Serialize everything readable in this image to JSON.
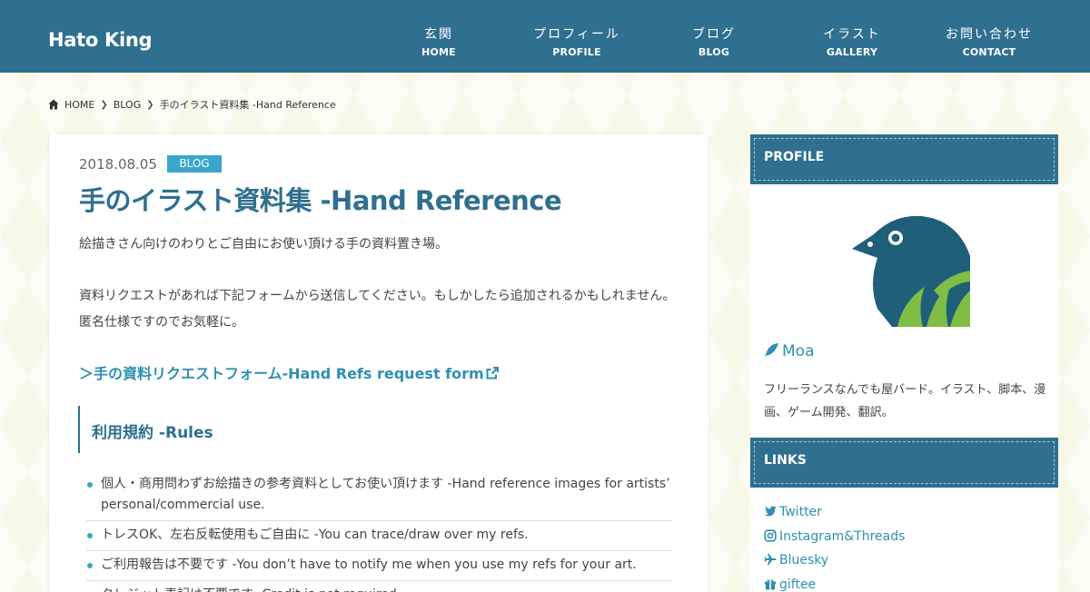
{
  "site": {
    "title": "Hato King"
  },
  "nav": [
    {
      "jp": "玄関",
      "en": "HOME"
    },
    {
      "jp": "プロフィール",
      "en": "PROFILE"
    },
    {
      "jp": "ブログ",
      "en": "BLOG"
    },
    {
      "jp": "イラスト",
      "en": "GALLERY"
    },
    {
      "jp": "お問い合わせ",
      "en": "CONTACT"
    }
  ],
  "breadcrumb": {
    "home": "HOME",
    "blog": "BLOG",
    "current": "手のイラスト資料集 -Hand Reference"
  },
  "post": {
    "date": "2018.08.05",
    "category": "BLOG",
    "title": "手のイラスト資料集 -Hand Reference",
    "intro": "絵描きさん向けのわりとご自由にお使い頂ける手の資料置き場。",
    "request": "資料リクエストがあれば下記フォームから送信してください。もしかしたら追加されるかもしれません。匿名仕様ですのでお気軽に。",
    "form_link": "＞手の資料リクエストフォーム-Hand Refs request form",
    "rules_heading": "利用規約 -Rules",
    "rules": [
      "個人・商用問わずお絵描きの参考資料としてお使い頂けます -Hand reference images for artists’ personal/commercial use.",
      "トレスOK、左右反転使用もご自由に -You can trace/draw over my refs.",
      "ご利用報告は不要です -You don’t have to notify me when you use my refs for your art.",
      "クレジット表記は不要です -Credit is not required."
    ]
  },
  "sidebar": {
    "profile_heading": "PROFILE",
    "author": "Moa",
    "bio": "フリーランスなんでも屋バード。イラスト、脚本、漫画、ゲーム開発、翻訳。",
    "links_heading": "LINKS",
    "links": [
      {
        "label": "Twitter",
        "icon": "twitter-icon"
      },
      {
        "label": "Instagram&Threads",
        "icon": "instagram-icon"
      },
      {
        "label": "Bluesky",
        "icon": "plane-icon"
      },
      {
        "label": "giftee",
        "icon": "gift-icon"
      }
    ]
  },
  "colors": {
    "header": "#2f6f8f",
    "accent": "#3aa6cc",
    "link": "#2f8fb3",
    "background": "#f8f8e8"
  }
}
